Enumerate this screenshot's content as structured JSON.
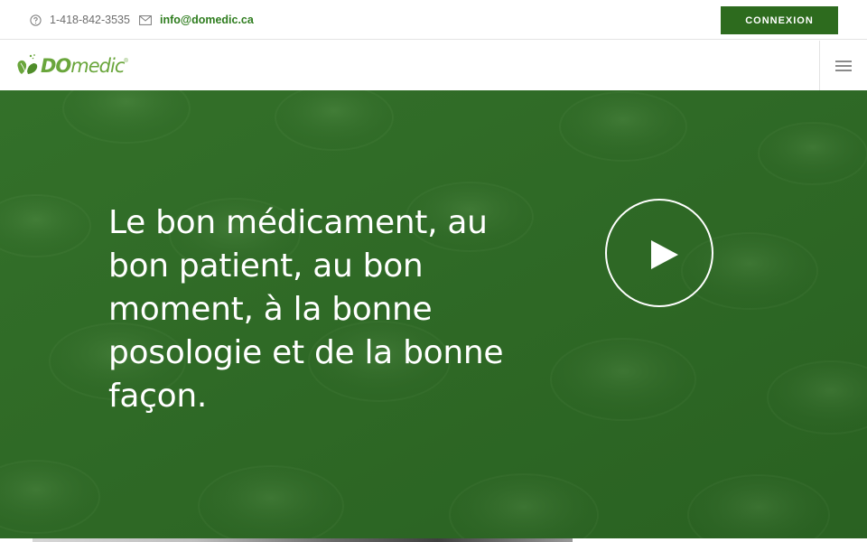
{
  "topbar": {
    "phone_icon": "question-circle-icon",
    "phone": "1-418-842-3535",
    "email_icon": "envelope-icon",
    "email": "info@domedic.ca",
    "login_label": "CONNEXION"
  },
  "navbar": {
    "logo": {
      "brand_prefix": "DO",
      "brand_suffix": "medic",
      "trademark": "®",
      "icon": "leaf-logo-icon"
    },
    "menu_icon": "hamburger-menu-icon"
  },
  "hero": {
    "heading": "Le bon médicament, au bon patient, au bon moment, à la bonne posologie et de la bonne façon.",
    "play_icon": "play-icon",
    "background": "pills-blister-photo"
  },
  "colors": {
    "brand_green": "#2d6b1e",
    "logo_green": "#6aa63c",
    "link_green": "#2f7d1f",
    "hero_overlay": "#2e6a25",
    "muted_text": "#6e6e6e",
    "border": "#e3e3e3"
  }
}
